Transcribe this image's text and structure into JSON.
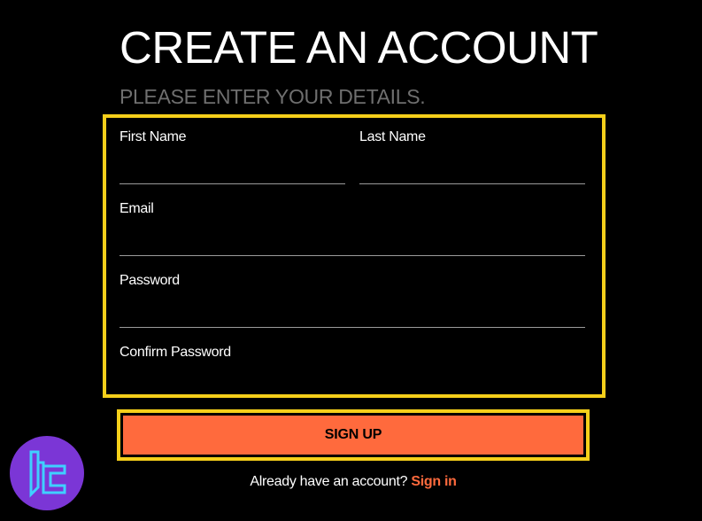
{
  "page": {
    "title": "CREATE AN ACCOUNT",
    "subtitle": "PLEASE ENTER YOUR DETAILS."
  },
  "form": {
    "first_name": {
      "label": "First Name",
      "value": "",
      "placeholder": ""
    },
    "last_name": {
      "label": "Last Name",
      "value": "",
      "placeholder": ""
    },
    "email": {
      "label": "Email",
      "value": "",
      "placeholder": ""
    },
    "password": {
      "label": "Password",
      "value": "",
      "placeholder": ""
    },
    "confirm_password": {
      "label": "Confirm Password",
      "value": "",
      "placeholder": ""
    },
    "submit_label": "SIGN UP"
  },
  "footer": {
    "prompt": "Already have an account?",
    "link_label": "Sign in"
  },
  "logo": {
    "icon": "brand-logo-icon"
  },
  "colors": {
    "background": "#000000",
    "accent": "#ff6a3d",
    "highlight_border": "#f5cf1a",
    "subtitle": "#6f6f6f",
    "logo_bg": "#7b36d6",
    "logo_glyph": "#3fd0ff"
  }
}
